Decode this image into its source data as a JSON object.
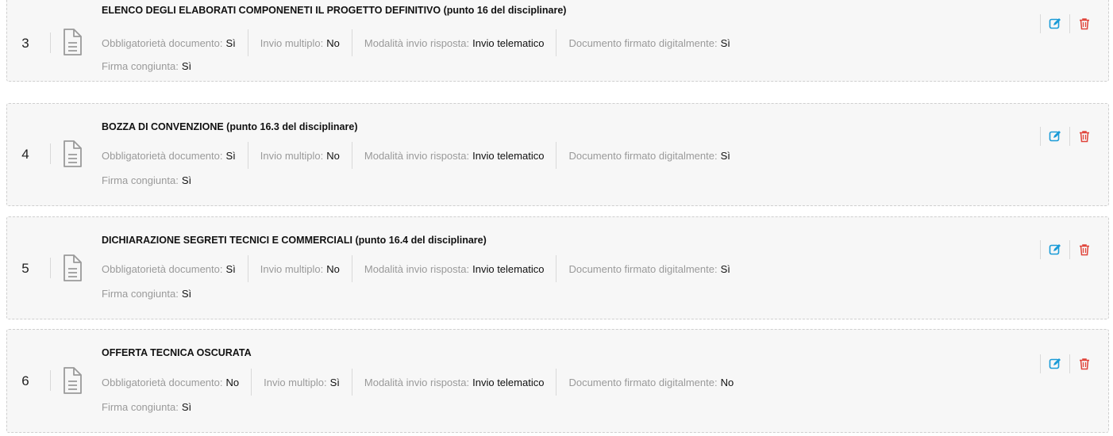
{
  "labels": {
    "obbligatorieta": "Obbligatorietà documento:",
    "invio_multiplo": "Invio multiplo:",
    "modalita": "Modalità invio risposta:",
    "firmato": "Documento firmato digitalmente:",
    "firma_congiunta": "Firma congiunta:"
  },
  "icons": {
    "document": "document-icon",
    "edit": "edit-icon",
    "delete": "trash-icon"
  },
  "colors": {
    "edit": "#1a9bd7",
    "delete": "#e0443a"
  },
  "documents": [
    {
      "number": "3",
      "title": "ELENCO DEGLI ELABORATI COMPONENETI IL PROGETTO DEFINITIVO (punto 16 del disciplinare)",
      "obbligatorieta": "Sì",
      "invio_multiplo": "No",
      "modalita": "Invio telematico",
      "firmato": "Sì",
      "firma_congiunta": "Sì"
    },
    {
      "number": "4",
      "title": "BOZZA DI CONVENZIONE (punto 16.3 del disciplinare)",
      "obbligatorieta": "Sì",
      "invio_multiplo": "No",
      "modalita": "Invio telematico",
      "firmato": "Sì",
      "firma_congiunta": "Sì"
    },
    {
      "number": "5",
      "title": "DICHIARAZIONE SEGRETI TECNICI E COMMERCIALI (punto 16.4 del disciplinare)",
      "obbligatorieta": "Sì",
      "invio_multiplo": "No",
      "modalita": "Invio telematico",
      "firmato": "Sì",
      "firma_congiunta": "Sì"
    },
    {
      "number": "6",
      "title": "OFFERTA TECNICA OSCURATA",
      "obbligatorieta": "No",
      "invio_multiplo": "Sì",
      "modalita": "Invio telematico",
      "firmato": "No",
      "firma_congiunta": "Sì"
    }
  ]
}
